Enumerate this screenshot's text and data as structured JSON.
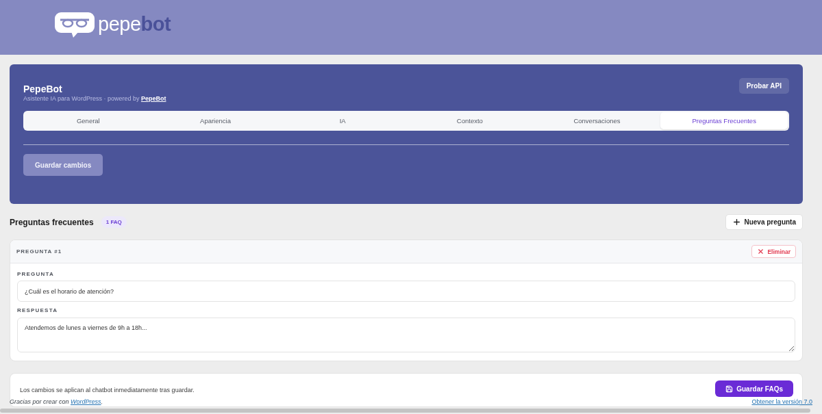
{
  "header": {
    "logo_text": "pepe**bot**"
  },
  "panel": {
    "title": "PepeBot",
    "subtitle": "Asistente IA para WordPress · powered by",
    "subtitle_link": "PepeBot",
    "api_button": "Probar API",
    "tabs": [
      {
        "label": "General",
        "selected": false
      },
      {
        "label": "Apariencia",
        "selected": false
      },
      {
        "label": "IA",
        "selected": false
      },
      {
        "label": "Contexto",
        "selected": false
      },
      {
        "label": "Conversaciones",
        "selected": false
      },
      {
        "label": "Preguntas Frecuentes",
        "selected": true
      }
    ],
    "save_button": "Guardar cambios"
  },
  "faq_section": {
    "title": "Preguntas frecuentes",
    "count_badge": "1 FAQ",
    "add_button": "Nueva pregunta",
    "items": [
      {
        "heading": "PREGUNTA #1",
        "delete_button": "Eliminar",
        "question_label": "PREGUNTA",
        "question": "¿Cuál es el horario de atención?",
        "answer_label": "RESPUESTA",
        "answer": "Atendemos de lunes a viernes de 9h a 18h..."
      }
    ]
  },
  "save_bar": {
    "note": "Los cambios se aplican al chatbot inmediatamente tras guardar.",
    "button": "Guardar FAQs"
  },
  "footer": {
    "thanks": "Gracias por crear con",
    "thanks_link": "WordPress",
    "thanks_end": ".",
    "version_link": "Obtener la versión 7.0"
  }
}
